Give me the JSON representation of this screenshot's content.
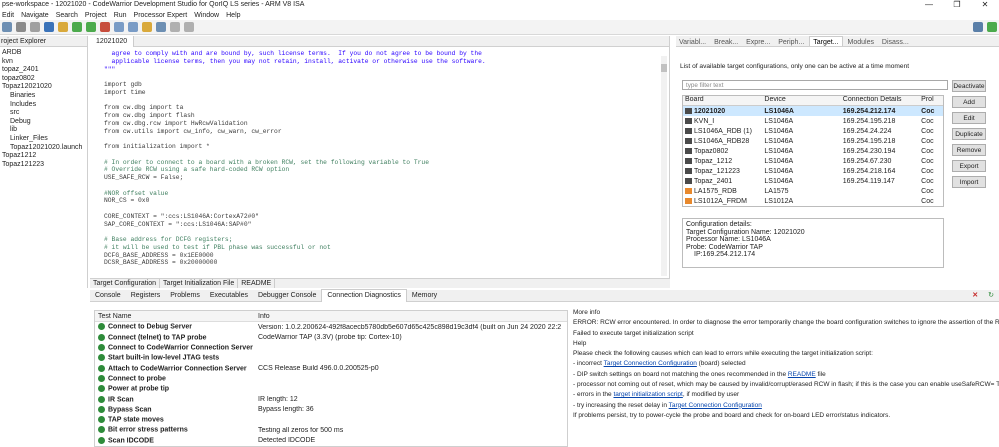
{
  "window": {
    "title": "pse-workspace - 12021020 - CodeWarrior Development Studio for QorIQ LS series - ARM V8 ISA",
    "controls": [
      "—",
      "❐",
      "✕"
    ]
  },
  "menu": [
    "Edit",
    "Navigate",
    "Search",
    "Project",
    "Run",
    "Processor Expert",
    "Window",
    "Help"
  ],
  "explorer": {
    "tab_label": "roject Explorer",
    "items": [
      "ARDB",
      "kvn",
      "topaz_2401",
      "topaz0802",
      "Topaz12021020",
      "Binaries",
      "Includes",
      "src",
      "Debug",
      "lib",
      "Linker_Files",
      "Topaz12021020.launch",
      "Topaz1212",
      "Topaz121223"
    ]
  },
  "editor": {
    "tab_label": "12021020",
    "bottom_tabs": [
      "Target Configuration",
      "Target Initialization File",
      "README"
    ],
    "code_lines": [
      {
        "t": "  agree to comply with and are bound by, such license terms.  If you do not agree to be bound by the",
        "c": "st"
      },
      {
        "t": "  applicable license terms, then you may not retain, install, activate or otherwise use the software.",
        "c": "st"
      },
      {
        "t": "\"\"\"",
        "c": "st"
      },
      {
        "t": "",
        "c": ""
      },
      {
        "t": "import gdb",
        "c": ""
      },
      {
        "t": "import time",
        "c": ""
      },
      {
        "t": "",
        "c": ""
      },
      {
        "t": "from cw.dbg import ta",
        "c": ""
      },
      {
        "t": "from cw.dbg import flash",
        "c": ""
      },
      {
        "t": "from cw.dbg.rcw import HwRcwValidation",
        "c": ""
      },
      {
        "t": "from cw.utils import cw_info, cw_warn, cw_error",
        "c": ""
      },
      {
        "t": "",
        "c": ""
      },
      {
        "t": "from initialization import *",
        "c": ""
      },
      {
        "t": "",
        "c": ""
      },
      {
        "t": "# In order to connect to a board with a broken RCW, set the following variable to True",
        "c": "cm"
      },
      {
        "t": "# Override RCW using a safe hard-coded RCW option",
        "c": "cm"
      },
      {
        "t": "USE_SAFE_RCW = False;",
        "c": ""
      },
      {
        "t": "",
        "c": ""
      },
      {
        "t": "#NOR offset value",
        "c": "cm"
      },
      {
        "t": "NOR_CS = 0x0",
        "c": ""
      },
      {
        "t": "",
        "c": ""
      },
      {
        "t": "CORE_CONTEXT = \":ccs:LS1046A:CortexA72#0\"",
        "c": ""
      },
      {
        "t": "SAP_CORE_CONTEXT = \":ccs:LS1046A:SAP#0\"",
        "c": ""
      },
      {
        "t": "",
        "c": ""
      },
      {
        "t": "# Base address for DCFG registers;",
        "c": "cm"
      },
      {
        "t": "# it will be used to test if PBL phase was successful or not",
        "c": "cm"
      },
      {
        "t": "DCFG_BASE_ADDRESS = 0x1EE0000",
        "c": ""
      },
      {
        "t": "DCSR_BASE_ADDRESS = 0x20000000",
        "c": ""
      }
    ]
  },
  "right": {
    "tabs": [
      "Variabl...",
      "Break...",
      "Expre...",
      "Periph...",
      "Target...",
      "Modules",
      "Disass..."
    ],
    "description": "List of available target configurations, only one can be active at a time moment",
    "filter_placeholder": "type filter text",
    "columns": [
      "Board",
      "Device",
      "Connection Details",
      "Prol"
    ],
    "rows": [
      {
        "board": "12021020",
        "device": "LS1046A",
        "conn": "169.254.212.174",
        "prol": "Coc",
        "selected": true,
        "icon": "board-icon"
      },
      {
        "board": "KVN_I",
        "device": "LS1046A",
        "conn": "169.254.195.218",
        "prol": "Coc",
        "selected": false,
        "icon": "board-icon"
      },
      {
        "board": "LS1046A_RDB (1)",
        "device": "LS1046A",
        "conn": "169.254.24.224",
        "prol": "Coc",
        "selected": false,
        "icon": "board-icon"
      },
      {
        "board": "LS1046A_RDB28",
        "device": "LS1046A",
        "conn": "169.254.195.218",
        "prol": "Coc",
        "selected": false,
        "icon": "board-icon"
      },
      {
        "board": "Topaz0802",
        "device": "LS1046A",
        "conn": "169.254.230.194",
        "prol": "Coc",
        "selected": false,
        "icon": "board-icon"
      },
      {
        "board": "Topaz_1212",
        "device": "LS1046A",
        "conn": "169.254.67.230",
        "prol": "Coc",
        "selected": false,
        "icon": "board-icon"
      },
      {
        "board": "Topaz_121223",
        "device": "LS1046A",
        "conn": "169.254.218.164",
        "prol": "Coc",
        "selected": false,
        "icon": "board-icon"
      },
      {
        "board": "Topaz_2401",
        "device": "LS1046A",
        "conn": "169.254.119.147",
        "prol": "Coc",
        "selected": false,
        "icon": "board-icon"
      },
      {
        "board": "LA1575_RDB",
        "device": "LA1575",
        "conn": "",
        "prol": "Coc",
        "selected": false,
        "icon": "board-orange-icon"
      },
      {
        "board": "LS1012A_FRDM",
        "device": "LS1012A",
        "conn": "",
        "prol": "Coc",
        "selected": false,
        "icon": "board-orange-icon"
      }
    ],
    "buttons": [
      "Deactivate",
      "Add",
      "Edit",
      "Duplicate",
      "Remove",
      "Export",
      "Import"
    ],
    "details_title": "Configuration details:",
    "details": [
      "Target Configuration Name: 12021020",
      "Processor Name: LS1046A",
      "Probe: CodeWarrior TAP",
      "IP:169.254.212.174"
    ]
  },
  "bottom": {
    "tabs": [
      "Console",
      "Registers",
      "Problems",
      "Executables",
      "Debugger Console",
      "Connection Diagnostics",
      "Memory"
    ],
    "active_tab": "Connection Diagnostics",
    "columns": [
      "Test Name",
      "Info"
    ],
    "rows": [
      {
        "name": "Connect to Debug Server",
        "info": "Version: 1.0.2.200624-492f8acecb5780db5e607d65c425c898d19c3df4 (built on Jun 24 2020 22:2"
      },
      {
        "name": "Connect (telnet) to TAP probe",
        "info": "CodeWarrior TAP (3.3V) (probe tip: Cortex-10)"
      },
      {
        "name": "Connect to CodeWarrior Connection Server",
        "info": ""
      },
      {
        "name": "Start built-in low-level JTAG tests",
        "info": ""
      },
      {
        "name": "Attach to CodeWarrior Connection Server",
        "info": "CCS Release Build 496.0.0.200525-p0"
      },
      {
        "name": "Connect to probe",
        "info": ""
      },
      {
        "name": "Power at probe tip",
        "info": ""
      },
      {
        "name": "IR Scan",
        "info": "IR length: 12"
      },
      {
        "name": "Bypass Scan",
        "info": "Bypass length: 36"
      },
      {
        "name": "TAP state moves",
        "info": ""
      },
      {
        "name": "Bit error stress patterns",
        "info": "Testing all zeros for 500 ms"
      },
      {
        "name": "Scan IDCODE",
        "info": "Detected IDCODE"
      }
    ],
    "more_info": {
      "title": "More info",
      "error": "ERROR: RCW error encountered. In order to diagnose the error temporarily change the board configuration switches to ignore the assertion of the RE",
      "failed": "Failed to execute target initialization script",
      "help_title": "Help",
      "help_intro": "Please check the following causes which can lead to errors while executing the target initialization script:",
      "c1_pre": "- incorrect ",
      "c1_link": "Target Connection Configuration",
      "c1_post": " (board) selected",
      "c2_pre": "- DIP switch settings on board not matching the ones recommended in the ",
      "c2_link": "README",
      "c2_post": " file",
      "c3": "- processor not coming out of reset, which may be caused by invalid/corrupt/erased RCW in flash; if this is the case you can enable useSafeRCW= Tru",
      "c4_pre": "- errors in the ",
      "c4_link": "target initialization script",
      "c4_post": ", if modified by user",
      "c5_pre": "- try increasing the reset delay in ",
      "c5_link": "Target Connection Configuration",
      "c6": "If problems persist, try to power-cycle the probe and board and check for on-board LED error/status indicators."
    }
  }
}
